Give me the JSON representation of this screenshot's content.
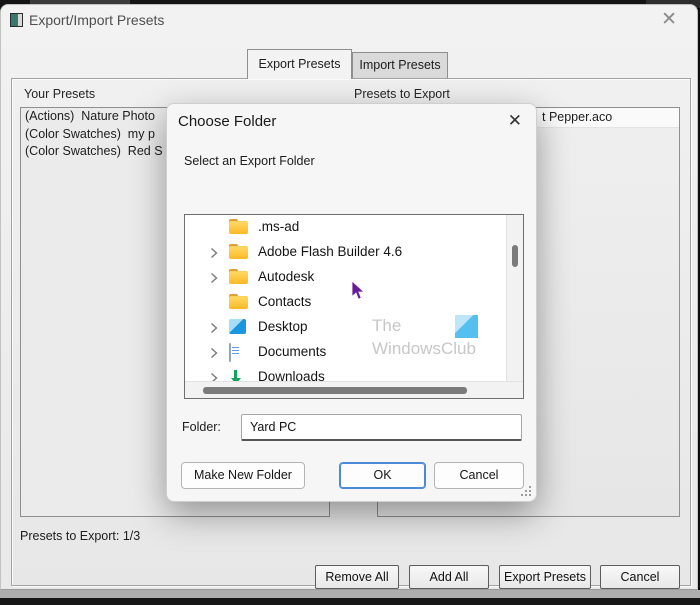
{
  "window": {
    "title": "Export/Import Presets",
    "close_icon": "✕",
    "tabs": [
      {
        "label": "Export Presets",
        "active": true
      },
      {
        "label": "Import Presets",
        "active": false
      }
    ],
    "left_panel": {
      "header": "Your Presets",
      "items": [
        "(Actions)  Nature Photo",
        "(Color Swatches)  my p",
        "(Color Swatches)  Red S"
      ]
    },
    "right_panel": {
      "header": "Presets to Export",
      "items": [
        "t Pepper.aco"
      ]
    },
    "status": "Presets to Export: 1/3",
    "buttons": [
      "Remove All",
      "Add All",
      "Export Presets",
      "Cancel"
    ]
  },
  "dialog": {
    "title": "Choose Folder",
    "close_icon": "✕",
    "subtitle": "Select an Export Folder",
    "tree": {
      "items": [
        {
          "label": ".ms-ad",
          "icon": "folder",
          "chevron": false
        },
        {
          "label": "Adobe Flash Builder 4.6",
          "icon": "folder",
          "chevron": true
        },
        {
          "label": "Autodesk",
          "icon": "folder",
          "chevron": true
        },
        {
          "label": "Contacts",
          "icon": "folder",
          "chevron": false
        },
        {
          "label": "Desktop",
          "icon": "desktop",
          "chevron": true
        },
        {
          "label": "Documents",
          "icon": "documents",
          "chevron": true
        },
        {
          "label": "Downloads",
          "icon": "downloads",
          "chevron": true
        }
      ]
    },
    "folder_label": "Folder:",
    "folder_value": "Yard PC",
    "buttons": {
      "make_new_folder": "Make New Folder",
      "ok": "OK",
      "cancel": "Cancel"
    }
  },
  "watermark": {
    "line1": "The",
    "line2": "WindowsClub"
  },
  "colors": {
    "window_bg": "#efefef",
    "dialog_bg": "#f6f6f6",
    "ok_border_blue": "#4b8bd6",
    "folder_yellow": "#fcb827",
    "desktop_blue": "#1d96e0",
    "downloads_green": "#13a55f",
    "cursor_purple": "#6a1b9a",
    "watermark_gray": "#c7c7c7",
    "logo_blue": "#55c0ef"
  }
}
